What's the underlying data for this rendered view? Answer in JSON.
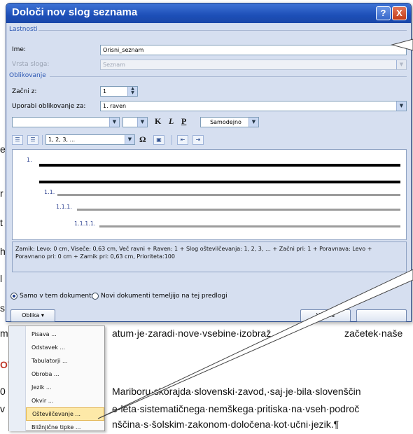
{
  "document": {
    "edge_chars": [
      "e",
      "r",
      "t",
      "h",
      "l",
      "s"
    ],
    "line1_left": "m",
    "line1_mid": "atum·je·zaradi·nove·vsebine·izobraž",
    "line1_right": "začetek·naše",
    "heading_left": "OV",
    "line2_left": "0",
    "line2": "Mariboru·skorajda·slovenski·zavod,·saj·je·bila·slovenščin",
    "line3_left": "v",
    "line3": "e·leta·sistematičnega·nemškega·pritiska·na·vseh·področ",
    "line4": "nščina·s·šolskim·zakonom·določena·kot·učni·jezik.¶"
  },
  "dialog": {
    "title": "Določi nov slog seznama",
    "help_glyph": "?",
    "close_glyph": "X",
    "properties_section": "Lastnosti",
    "name_label": "Ime:",
    "name_value": "Orisni_seznam",
    "style_type_label": "Vrsta sloga:",
    "style_type_value": "Seznam",
    "formatting_section": "Oblikovanje",
    "start_at_label": "Začni z:",
    "start_at_value": "1",
    "apply_to_label": "Uporabi oblikovanje za:",
    "apply_to_value": "1. raven",
    "font_color_value": "Samodejno",
    "bold_glyph": "K",
    "italic_glyph": "L",
    "underline_glyph": "P",
    "numbering_value": "1, 2, 3, ...",
    "symbol_glyph": "Ω",
    "preview": {
      "level1": "1.",
      "level2": "1.1.",
      "level3": "1.1.1.",
      "level4": "1.1.1.1."
    },
    "description": "Zamik: Levo: 0 cm, Viseče: 0,63 cm, Več ravni + Raven: 1 + Slog oštevilčevanja: 1, 2, 3, … + Začni pri: 1 + Poravnava: Levo + Poravnano pri: 0 cm + Zamik pri: 0,63 cm, Prioriteta:100",
    "radio_this_document": "Samo v tem dokumentu",
    "radio_new_documents": "Novi dokumenti temeljijo na tej predlogi",
    "format_button": "Oblika",
    "ok_button": "V redu"
  },
  "menu": {
    "items": [
      "Pisava ...",
      "Odstavek ...",
      "Tabulatorji ...",
      "Obroba ...",
      "Jezik ...",
      "Okvir ...",
      "Oštevilčevanje ...",
      "Bližnjične tipke ..."
    ],
    "selected_index": 6
  },
  "colors": {
    "titlebar": "#1d4fb8",
    "dialog_bg": "#d6dff0",
    "section_text": "#2b57b3",
    "menu_highlight": "#fde9a8",
    "doc_heading": "#c0392b"
  }
}
